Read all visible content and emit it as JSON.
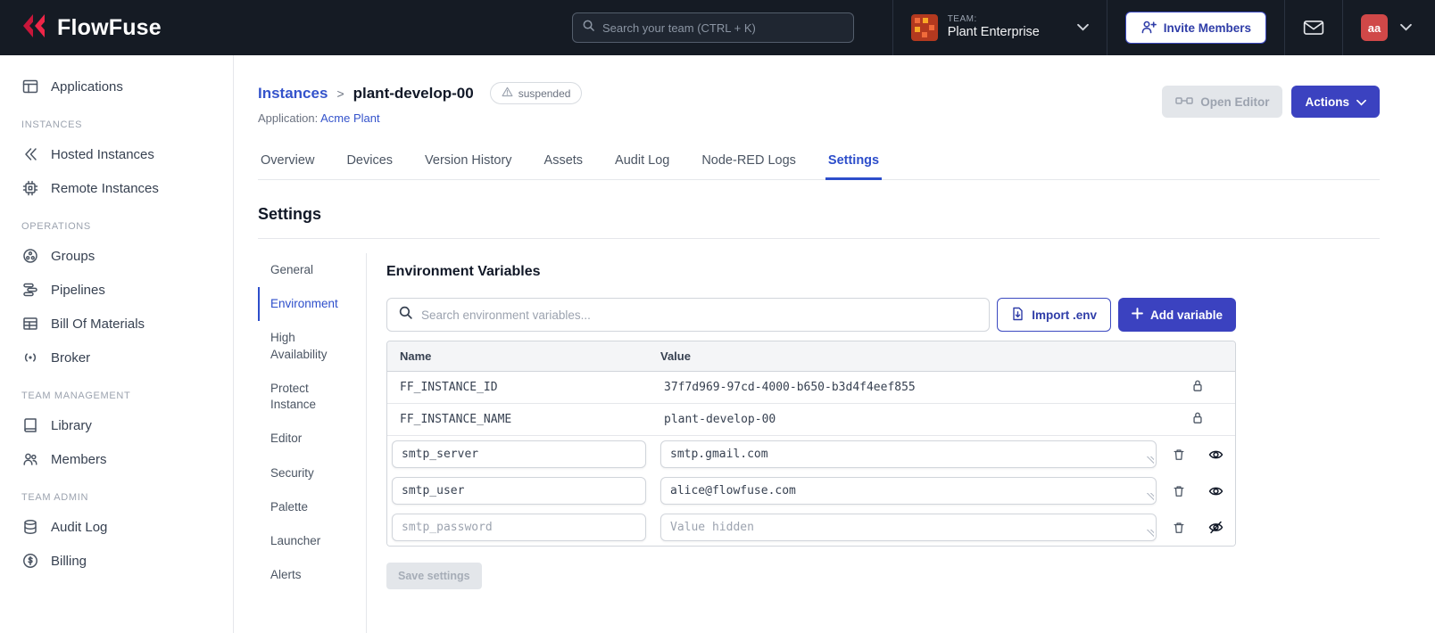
{
  "colors": {
    "navbar_bg": "#151b24",
    "accent_button": "#3b42c0",
    "link": "#3453cb",
    "brand_red": "#e11d40",
    "avatar_bg": "#d04848",
    "disabled_bg": "#e3e6ea",
    "disabled_text": "#9ca3af"
  },
  "navbar": {
    "brand": "FlowFuse",
    "search_placeholder": "Search your team (CTRL + K)",
    "team_label": "TEAM:",
    "team_name": "Plant Enterprise",
    "invite_button": "Invite Members",
    "avatar_initials": "aa"
  },
  "sidebar": {
    "applications": "Applications",
    "sections": [
      {
        "label": "INSTANCES",
        "items": [
          "Hosted Instances",
          "Remote Instances"
        ]
      },
      {
        "label": "OPERATIONS",
        "items": [
          "Groups",
          "Pipelines",
          "Bill Of Materials",
          "Broker"
        ]
      },
      {
        "label": "TEAM MANAGEMENT",
        "items": [
          "Library",
          "Members"
        ]
      },
      {
        "label": "TEAM ADMIN",
        "items": [
          "Audit Log",
          "Billing"
        ]
      }
    ]
  },
  "header": {
    "breadcrumb": "Instances",
    "separator": ">",
    "instance_name": "plant-develop-00",
    "status": "suspended",
    "application_label": "Application:",
    "application_name": "Acme Plant",
    "open_editor": "Open Editor",
    "actions": "Actions"
  },
  "tabs": [
    "Overview",
    "Devices",
    "Version History",
    "Assets",
    "Audit Log",
    "Node-RED Logs",
    "Settings"
  ],
  "active_tab": "Settings",
  "settings": {
    "title": "Settings",
    "nav": [
      "General",
      "Environment",
      "High Availability",
      "Protect Instance",
      "Editor",
      "Security",
      "Palette",
      "Launcher",
      "Alerts"
    ],
    "active_nav": "Environment",
    "heading": "Environment Variables",
    "search_placeholder": "Search environment variables...",
    "import_button": "Import .env",
    "add_button": "Add variable",
    "save_button": "Save settings",
    "table": {
      "name_header": "Name",
      "value_header": "Value",
      "locked_rows": [
        {
          "name": "FF_INSTANCE_ID",
          "value": "37f7d969-97cd-4000-b650-b3d4f4eef855"
        },
        {
          "name": "FF_INSTANCE_NAME",
          "value": "plant-develop-00"
        }
      ],
      "editable_rows": [
        {
          "name": "smtp_server",
          "value": "smtp.gmail.com",
          "hidden": false
        },
        {
          "name": "smtp_user",
          "value": "alice@flowfuse.com",
          "hidden": false
        },
        {
          "name": "smtp_password",
          "value": "",
          "value_placeholder": "Value hidden",
          "hidden": true
        }
      ]
    }
  }
}
